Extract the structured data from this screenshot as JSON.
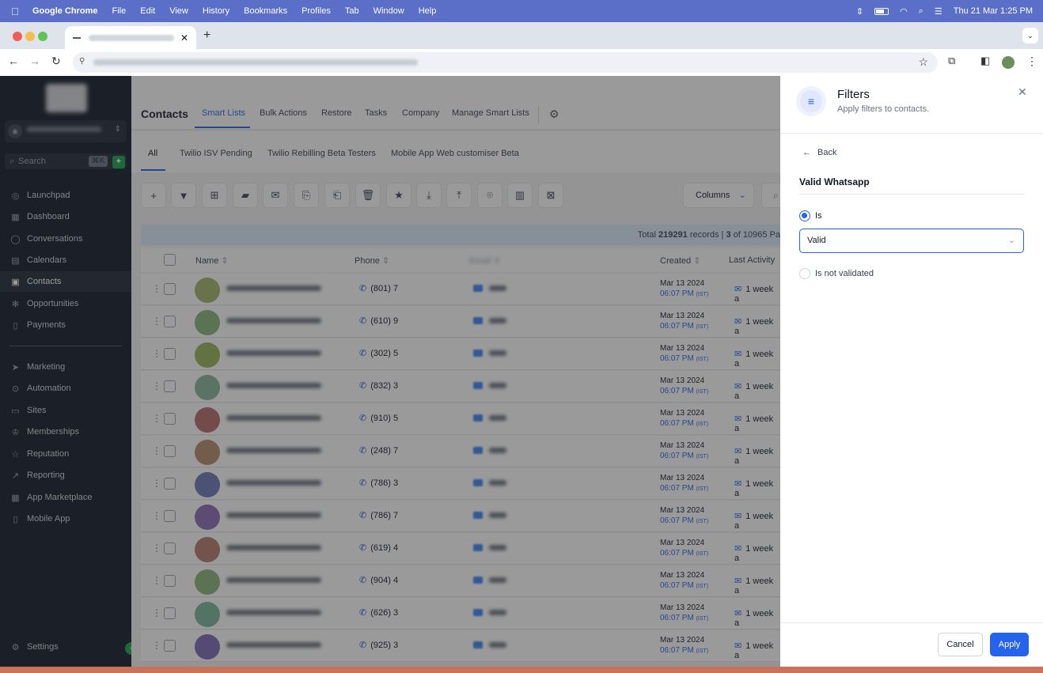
{
  "menubar": {
    "app": "Google Chrome",
    "items": [
      "File",
      "Edit",
      "View",
      "History",
      "Bookmarks",
      "Profiles",
      "Tab",
      "Window",
      "Help"
    ],
    "datetime": "Thu 21 Mar  1:25 PM"
  },
  "sidebar": {
    "search_placeholder": "Search",
    "search_shortcut": "⌘K",
    "items": [
      {
        "label": "Launchpad",
        "icon": "rocket-icon"
      },
      {
        "label": "Dashboard",
        "icon": "grid-icon"
      },
      {
        "label": "Conversations",
        "icon": "chat-icon"
      },
      {
        "label": "Calendars",
        "icon": "calendar-icon"
      },
      {
        "label": "Contacts",
        "icon": "contacts-icon",
        "active": true
      },
      {
        "label": "Opportunities",
        "icon": "network-icon"
      },
      {
        "label": "Payments",
        "icon": "receipt-icon"
      }
    ],
    "items2": [
      {
        "label": "Marketing",
        "icon": "send-icon"
      },
      {
        "label": "Automation",
        "icon": "automation-icon"
      },
      {
        "label": "Sites",
        "icon": "sites-icon"
      },
      {
        "label": "Memberships",
        "icon": "memberships-icon"
      },
      {
        "label": "Reputation",
        "icon": "star-icon"
      },
      {
        "label": "Reporting",
        "icon": "chart-icon"
      },
      {
        "label": "App Marketplace",
        "icon": "apps-icon"
      },
      {
        "label": "Mobile App",
        "icon": "phone-icon"
      }
    ],
    "settings": "Settings"
  },
  "topnav": {
    "title": "Contacts",
    "tabs": [
      "Smart Lists",
      "Bulk Actions",
      "Restore",
      "Tasks",
      "Company",
      "Manage Smart Lists"
    ]
  },
  "subtabs": [
    "All",
    "Twilio ISV Pending",
    "Twilio Rebilling Beta Testers",
    "Mobile App Web customiser Beta"
  ],
  "toolbar": {
    "columns_label": "Columns"
  },
  "stats": {
    "prefix": "Total ",
    "total": "219291",
    "mid": " records | ",
    "page": "3",
    "suffix": " of 10965 Pa"
  },
  "table": {
    "headers": {
      "name": "Name",
      "phone": "Phone",
      "email": "Email",
      "created": "Created",
      "last_activity": "Last Activity"
    },
    "rows": [
      {
        "phone": "(801) 7",
        "date": "Mar 13 2024",
        "time": "06:07 PM",
        "tz": "(IST)",
        "activity": "1 week a",
        "color": "#a3b36b"
      },
      {
        "phone": "(610) 9",
        "date": "Mar 13 2024",
        "time": "06:07 PM",
        "tz": "(IST)",
        "activity": "1 week a",
        "color": "#86b67a"
      },
      {
        "phone": "(302) 5",
        "date": "Mar 13 2024",
        "time": "06:07 PM",
        "tz": "(IST)",
        "activity": "1 week a",
        "color": "#9ab35a"
      },
      {
        "phone": "(832) 3",
        "date": "Mar 13 2024",
        "time": "06:07 PM",
        "tz": "(IST)",
        "activity": "1 week a",
        "color": "#86b69a"
      },
      {
        "phone": "(910) 5",
        "date": "Mar 13 2024",
        "time": "06:07 PM",
        "tz": "(IST)",
        "activity": "1 week a",
        "color": "#b66a6a"
      },
      {
        "phone": "(248) 7",
        "date": "Mar 13 2024",
        "time": "06:07 PM",
        "tz": "(IST)",
        "activity": "1 week a",
        "color": "#b88a6a"
      },
      {
        "phone": "(786) 3",
        "date": "Mar 13 2024",
        "time": "06:07 PM",
        "tz": "(IST)",
        "activity": "1 week a",
        "color": "#6a78b6"
      },
      {
        "phone": "(786) 7",
        "date": "Mar 13 2024",
        "time": "06:07 PM",
        "tz": "(IST)",
        "activity": "1 week a",
        "color": "#8a6ab6"
      },
      {
        "phone": "(619) 4",
        "date": "Mar 13 2024",
        "time": "06:07 PM",
        "tz": "(IST)",
        "activity": "1 week a",
        "color": "#b67a6a"
      },
      {
        "phone": "(904) 4",
        "date": "Mar 13 2024",
        "time": "06:07 PM",
        "tz": "(IST)",
        "activity": "1 week a",
        "color": "#8ab67a"
      },
      {
        "phone": "(626) 3",
        "date": "Mar 13 2024",
        "time": "06:07 PM",
        "tz": "(IST)",
        "activity": "1 week a",
        "color": "#7ab69a"
      },
      {
        "phone": "(925) 3",
        "date": "Mar 13 2024",
        "time": "06:07 PM",
        "tz": "(IST)",
        "activity": "1 week a",
        "color": "#7a6ab6"
      }
    ]
  },
  "filters": {
    "title": "Filters",
    "subtitle": "Apply filters to contacts.",
    "back": "Back",
    "field": "Valid Whatsapp",
    "option_is": "Is",
    "selected_value": "Valid",
    "option_not": "Is not validated",
    "cancel": "Cancel",
    "apply": "Apply"
  },
  "colors": {
    "accent": "#2563eb",
    "sidebar_bg": "#101827"
  }
}
